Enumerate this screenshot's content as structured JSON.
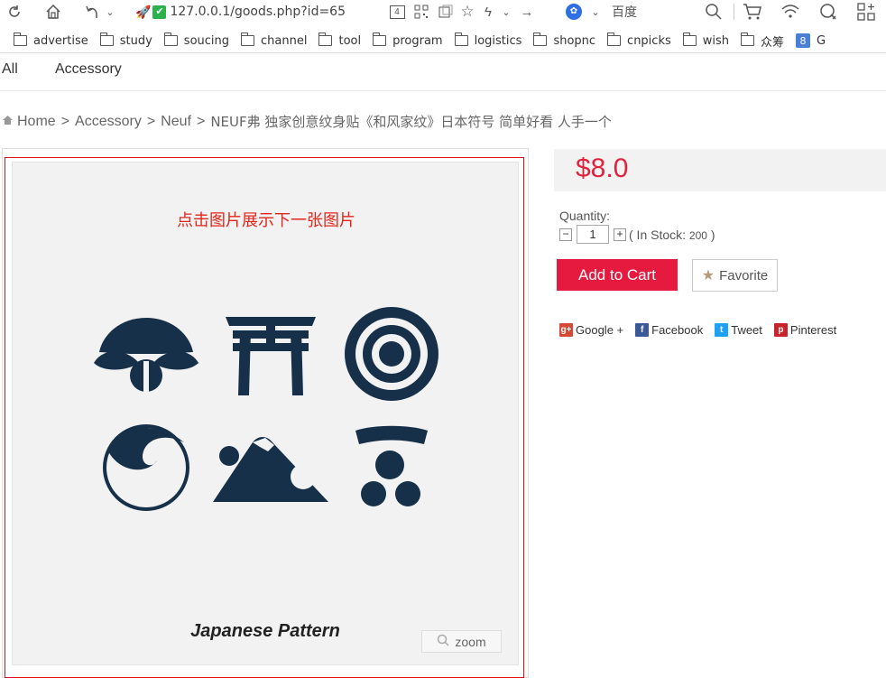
{
  "browser": {
    "url": "127.0.0.1/goods.php?id=65",
    "search_engine_label": "百度",
    "tab_count": "4"
  },
  "bookmarks": [
    "advertise",
    "study",
    "soucing",
    "channel",
    "tool",
    "program",
    "logistics",
    "shopnc",
    "cnpicks",
    "wish",
    "众筹"
  ],
  "bookmark_last": "G",
  "nav": {
    "items": [
      "All",
      "Accessory"
    ]
  },
  "breadcrumb": {
    "home": "Home",
    "sep": ">",
    "level1": "Accessory",
    "level2": "Neuf",
    "current": "NEUF弗 独家创意纹身贴《和风家纹》日本符号 简单好看 人手一个"
  },
  "gallery": {
    "hint": "点击图片展示下一张图片",
    "image_caption": "Japanese Pattern",
    "zoom_label": "zoom"
  },
  "product": {
    "price": "$8.0",
    "quantity_label": "Quantity:",
    "quantity_value": "1",
    "stock_prefix": "( In Stock: ",
    "stock_count": "200",
    "stock_suffix": " )",
    "add_to_cart": "Add to Cart",
    "favorite": "Favorite"
  },
  "share": [
    "Google +",
    "Facebook",
    "Tweet",
    "Pinterest"
  ],
  "colors": {
    "accent": "#e6193f",
    "price": "#e0223c",
    "hint": "#e0261b",
    "icon_navy": "#16304a"
  }
}
